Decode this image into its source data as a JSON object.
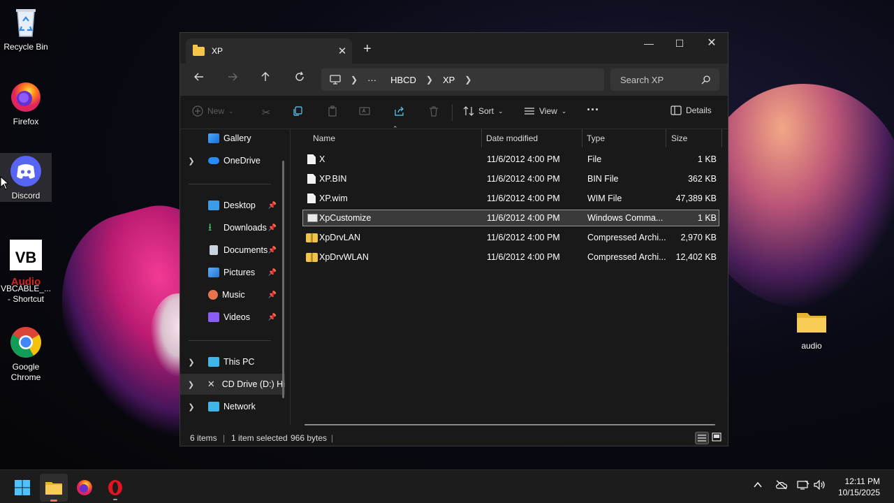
{
  "desktop": {
    "icons": [
      {
        "label": "Recycle Bin"
      },
      {
        "label": "Firefox"
      },
      {
        "label": "Discord"
      },
      {
        "label": "VBCABLE_...\n- Shortcut"
      },
      {
        "label": "Google\nChrome"
      },
      {
        "label": "audio"
      }
    ],
    "vb_text_top": "VB",
    "vb_text_bottom": "Audio"
  },
  "window": {
    "tab_title": "XP",
    "new_tab": "+",
    "controls": {
      "minimize": "—",
      "maximize": "☐",
      "close": "✕"
    },
    "breadcrumb": {
      "ellipsis": "···",
      "items": [
        "HBCD",
        "XP"
      ]
    },
    "search_placeholder": "Search XP",
    "toolbar": {
      "new_label": "New",
      "sort_label": "Sort",
      "view_label": "View",
      "more_label": "···",
      "details_label": "Details"
    },
    "sidebar": {
      "items": [
        {
          "label": "Gallery"
        },
        {
          "label": "OneDrive"
        },
        {
          "label": "Desktop"
        },
        {
          "label": "Downloads"
        },
        {
          "label": "Documents"
        },
        {
          "label": "Pictures"
        },
        {
          "label": "Music"
        },
        {
          "label": "Videos"
        },
        {
          "label": "This PC"
        },
        {
          "label": "CD Drive (D:) Hi"
        },
        {
          "label": "Network"
        }
      ]
    },
    "columns": {
      "name": "Name",
      "date": "Date modified",
      "type": "Type",
      "size": "Size"
    },
    "files": [
      {
        "name": "X",
        "date": "11/6/2012 4:00 PM",
        "type": "File",
        "size": "1 KB",
        "icon": "file-icon"
      },
      {
        "name": "XP.BIN",
        "date": "11/6/2012 4:00 PM",
        "type": "BIN File",
        "size": "362 KB",
        "icon": "file-icon"
      },
      {
        "name": "XP.wim",
        "date": "11/6/2012 4:00 PM",
        "type": "WIM File",
        "size": "47,389 KB",
        "icon": "file-icon"
      },
      {
        "name": "XpCustomize",
        "date": "11/6/2012 4:00 PM",
        "type": "Windows Comma...",
        "size": "1 KB",
        "icon": "cmd-file-icon"
      },
      {
        "name": "XpDrvLAN",
        "date": "11/6/2012 4:00 PM",
        "type": "Compressed Archi...",
        "size": "2,970 KB",
        "icon": "zip-folder-icon"
      },
      {
        "name": "XpDrvWLAN",
        "date": "11/6/2012 4:00 PM",
        "type": "Compressed Archi...",
        "size": "12,402 KB",
        "icon": "zip-folder-icon"
      }
    ],
    "status": {
      "count": "6 items",
      "selection": "1 item selected",
      "bytes": "966 bytes",
      "sep": "|"
    }
  },
  "taskbar": {
    "time": "12:11 PM",
    "date": "10/15/2025"
  },
  "colors": {
    "accent": "#60cdff",
    "folder": "#f5c448",
    "selection": "#3a3a3a"
  }
}
